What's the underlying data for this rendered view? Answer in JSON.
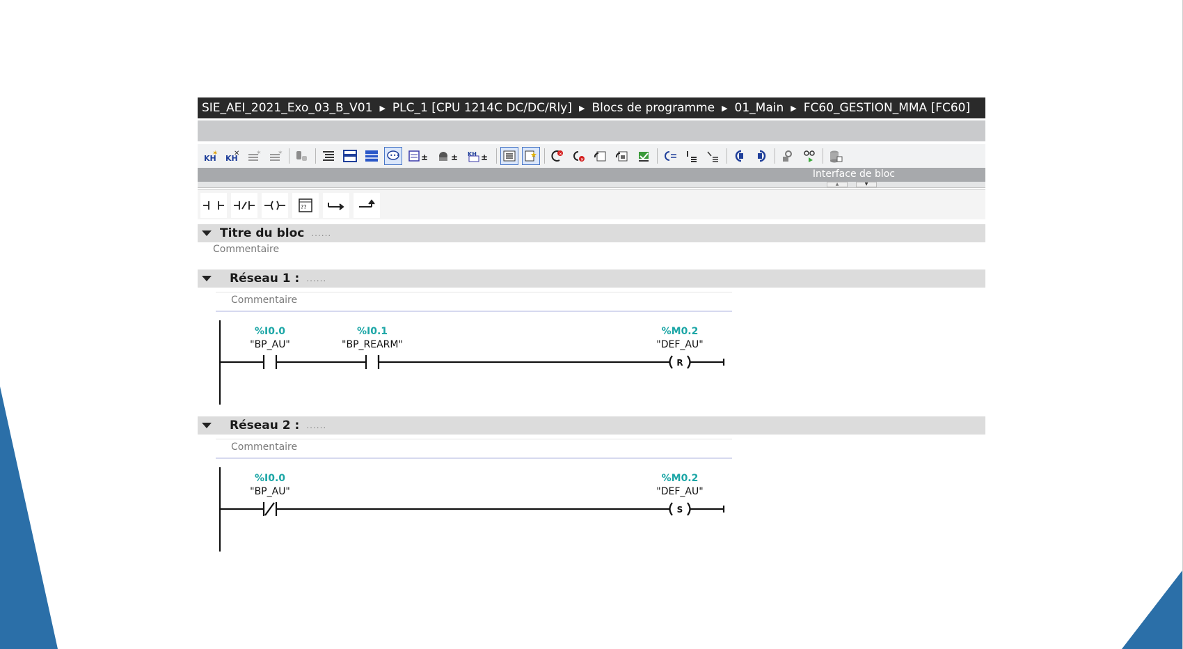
{
  "breadcrumb": {
    "items": [
      "SIE_AEI_2021_Exo_03_B_V01",
      "PLC_1 [CPU 1214C DC/DC/Rly]",
      "Blocs de programme",
      "01_Main",
      "FC60_GESTION_MMA [FC60]"
    ]
  },
  "interface_bar": {
    "label": "Interface de bloc"
  },
  "toolbar": {
    "icons": [
      "insert-network-icon",
      "delete-network-icon",
      "insert-row-icon",
      "add-row-icon",
      "toggle-icon",
      "absolute-operands-icon",
      "favorites-icon",
      "networks-icon",
      "comments-icon",
      "open-all-networks-icon",
      "close-all-networks-icon",
      "watch-icon",
      "outline-icon",
      "show-favorites-icon",
      "go-to-error-icon",
      "previous-error-icon",
      "next-error-icon",
      "navigate-icon",
      "update-icon",
      "previous-icon",
      "indent-icon",
      "outdent-icon",
      "jump-back-icon",
      "jump-forward-icon",
      "monitoring-icon",
      "display-icon",
      "db-icon"
    ]
  },
  "ladder_palette": {
    "items": [
      "contact-no-icon",
      "contact-nc-icon",
      "coil-icon",
      "empty-box-icon",
      "open-branch-icon",
      "close-branch-icon"
    ]
  },
  "block": {
    "title": "Titre du bloc",
    "title_dots": "......",
    "comment": "Commentaire"
  },
  "networks": [
    {
      "title": "Réseau 1 :",
      "dots": "......",
      "comment": "Commentaire",
      "contacts": [
        {
          "address": "%I0.0",
          "name": "\"BP_AU\"",
          "type": "NO"
        },
        {
          "address": "%I0.1",
          "name": "\"BP_REARM\"",
          "type": "NO"
        }
      ],
      "coil": {
        "address": "%M0.2",
        "name": "\"DEF_AU\"",
        "letter": "R"
      }
    },
    {
      "title": "Réseau 2 :",
      "dots": "......",
      "comment": "Commentaire",
      "contacts": [
        {
          "address": "%I0.0",
          "name": "\"BP_AU\"",
          "type": "NC"
        }
      ],
      "coil": {
        "address": "%M0.2",
        "name": "\"DEF_AU\"",
        "letter": "S"
      }
    }
  ],
  "colors": {
    "breadcrumb_bg": "#2a2a2a",
    "operand_address": "#1ca6a6",
    "slide_accent": "#2b6fa8"
  }
}
